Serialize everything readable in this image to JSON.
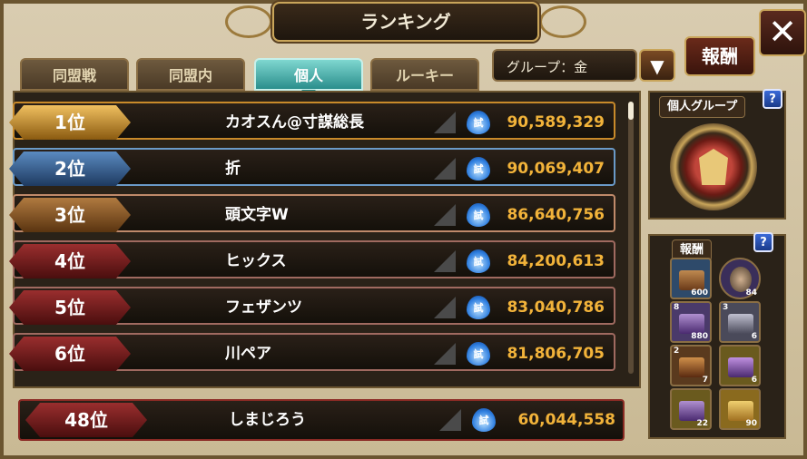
{
  "header": {
    "title": "ランキング",
    "close_label": "✕"
  },
  "tabs": [
    {
      "label": "同盟戦",
      "active": false
    },
    {
      "label": "同盟内",
      "active": false
    },
    {
      "label": "個人",
      "active": true
    },
    {
      "label": "ルーキー",
      "active": false
    }
  ],
  "group_select": {
    "value": "グループ：金",
    "arrow": "▼"
  },
  "reward_button": {
    "label": "報酬"
  },
  "ranking": [
    {
      "rank": "1位",
      "name": "カオスん@寸謀総長",
      "icon_text": "試",
      "power": "90,589,329"
    },
    {
      "rank": "2位",
      "name": "折",
      "icon_text": "試",
      "power": "90,069,407"
    },
    {
      "rank": "3位",
      "name": "頭文字W",
      "icon_text": "試",
      "power": "86,640,756"
    },
    {
      "rank": "4位",
      "name": "ヒックス",
      "icon_text": "試",
      "power": "84,200,613"
    },
    {
      "rank": "5位",
      "name": "フェザンツ",
      "icon_text": "試",
      "power": "83,040,786"
    },
    {
      "rank": "6位",
      "name": "川ペア",
      "icon_text": "試",
      "power": "81,806,705"
    }
  ],
  "my_rank": {
    "rank": "48位",
    "name": "しまじろう",
    "icon_text": "試",
    "power": "60,044,558"
  },
  "side_group": {
    "title": "個人グループ",
    "help": "?"
  },
  "side_reward": {
    "title": "報酬",
    "help": "?",
    "items": [
      {
        "icon": "chest-icon",
        "qty": "600",
        "plus": ""
      },
      {
        "icon": "character-portrait-icon",
        "qty": "84",
        "plus": ""
      },
      {
        "icon": "purple-chest-icon",
        "qty": "880",
        "plus": "8"
      },
      {
        "icon": "armor-icon",
        "qty": "6",
        "plus": "3"
      },
      {
        "icon": "bronze-gear-icon",
        "qty": "7",
        "plus": "2"
      },
      {
        "icon": "gold-chest-icon",
        "qty": "6",
        "plus": ""
      },
      {
        "icon": "gold-mystery-chest-icon",
        "qty": "22",
        "plus": ""
      },
      {
        "icon": "ticket-icon",
        "qty": "90",
        "plus": ""
      }
    ]
  },
  "colors": {
    "rank1": "#c98a2a",
    "rank2": "#2e5a8a",
    "rank3": "#8a5a2a",
    "rank_other": "#7a1e1e",
    "power_text": "#f2b33a"
  }
}
